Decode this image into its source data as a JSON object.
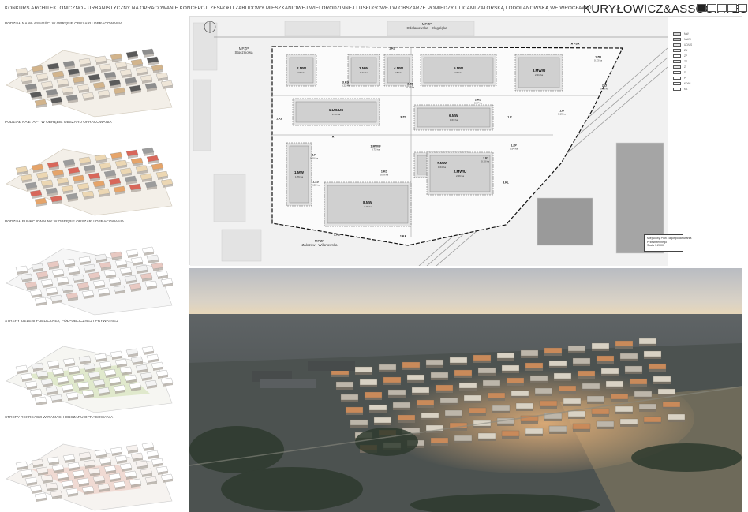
{
  "header": {
    "title": "KONKURS ARCHITEKTONICZNO - URBANISTYCZNY NA OPRACOWANIE KONCEPCJI ZESPOŁU ZABUDOWY MIESZKANIOWEJ WIELORODZINNEJ I USŁUGOWEJ W OBSZARZE POMIĘDZY ULICAMI ZATORSKĄ I ODOLANOWSKĄ WE WROCŁAWIU",
    "brand": "KURYŁOWICZ&ASSOCIATES"
  },
  "panels": [
    {
      "label": "PODZIAŁ NA WŁASNOŚCI W OBRĘBIE OBSZARU OPRACOWANIA"
    },
    {
      "label": "PODZIAŁ NA ETAPY W OBRĘBIE OBSZARU OPRACOWANIA"
    },
    {
      "label": "PODZIAŁ FUNKCJONALNY W OBRĘBIE OBSZARU OPRACOWANIA"
    },
    {
      "label": "STREFY ZIELENI PUBLICZNEJ, PÓŁPUBLICZNEJ I PRYWATNEJ"
    },
    {
      "label": "STREFY REKREACJI W RAMACH OBSZARU OPRACOWANIA"
    }
  ],
  "map": {
    "north_label": "MPZP\nOdolanowska - Długolęka",
    "west_label": "MPZP\nStoczniowa",
    "south_label": "MPZP\nZakrzów - Wilanowska",
    "plan_box": [
      "Miejscowy Plan Zagospodarowania",
      "Przestrzennego",
      "Skala 1:2000"
    ],
    "zones": [
      {
        "code": "2.MW",
        "area": "2.55 ha"
      },
      {
        "code": "3.MW",
        "area": "1.21 ha"
      },
      {
        "code": "4.MW",
        "area": "0.82 ha"
      },
      {
        "code": "5.MW",
        "area": "2.50 ha"
      },
      {
        "code": "3.MW/U",
        "area": "2.21 ha"
      },
      {
        "code": "1.ZU",
        "area": "0.13 ha"
      },
      {
        "code": "3.KD",
        "area": "0.22 ha"
      },
      {
        "code": "2.ZS",
        "area": "0.19 ha"
      },
      {
        "code": "2.ZI",
        "area": "0.43 ha"
      },
      {
        "code": "1.UO/US",
        "area": "2.50 ha"
      },
      {
        "code": "2.KD",
        "area": "0.57 ha"
      },
      {
        "code": "6.MW",
        "area": "1.63 ha"
      },
      {
        "code": "3.ZS",
        "area": ""
      },
      {
        "code": "1.P",
        "area": ""
      },
      {
        "code": "1.D",
        "area": "0.13 ha"
      },
      {
        "code": "1.KZ",
        "area": ""
      },
      {
        "code": "1.KL",
        "area": ""
      },
      {
        "code": "1.MW/U",
        "area": "0.71 ha"
      },
      {
        "code": "1.ZP",
        "area": "0.54 ha"
      },
      {
        "code": "3.P",
        "area": "0.10 ha"
      },
      {
        "code": "2.P",
        "area": "0.10 ha"
      },
      {
        "code": "7.MW",
        "area": "1.64 ha"
      },
      {
        "code": "2.MW/U",
        "area": "2.26 ha"
      },
      {
        "code": "1.MW",
        "area": "1.76 ha"
      },
      {
        "code": "1.ZS",
        "area": "0.20 ha"
      },
      {
        "code": "1.KD",
        "area": "0.89 ha"
      },
      {
        "code": "8.MW",
        "area": "2.18 ha"
      },
      {
        "code": "3.KL",
        "area": ""
      },
      {
        "code": "2.KL",
        "area": ""
      },
      {
        "code": "1.KA",
        "area": ""
      },
      {
        "code": "A",
        "area": ""
      },
      {
        "code": "A PSR",
        "area": ""
      }
    ]
  },
  "legend": {
    "items": [
      {
        "code": "MW",
        "color": "#d9d9d9"
      },
      {
        "code": "MW/U",
        "color": "#c7c7c7"
      },
      {
        "code": "UO/US",
        "color": "#e6e6e6"
      },
      {
        "code": "ZU",
        "color": "#f0f0f0"
      },
      {
        "code": "ZP",
        "color": "#ffffff"
      },
      {
        "code": "ZS",
        "color": "#eeeeee"
      },
      {
        "code": "ZI",
        "color": "#eaeaea"
      },
      {
        "code": "D",
        "color": "#ffffff"
      },
      {
        "code": "P",
        "color": "#ffffff"
      },
      {
        "code": "KD/KL",
        "color": "#ffffff"
      },
      {
        "code": "KA",
        "color": "#ffffff"
      }
    ]
  },
  "colors": {
    "building_light": "#efe6d8",
    "building_tan": "#d2b48c",
    "building_dark": "#5a5a5a",
    "stage_red": "#d8675a",
    "stage_orange": "#e5a46a",
    "stage_beige": "#ecd7b3",
    "green": "#c9d7a8",
    "sky_top": "#c4c5c8",
    "sky_bottom": "#e9dcc2",
    "field": "#6f6a58"
  }
}
